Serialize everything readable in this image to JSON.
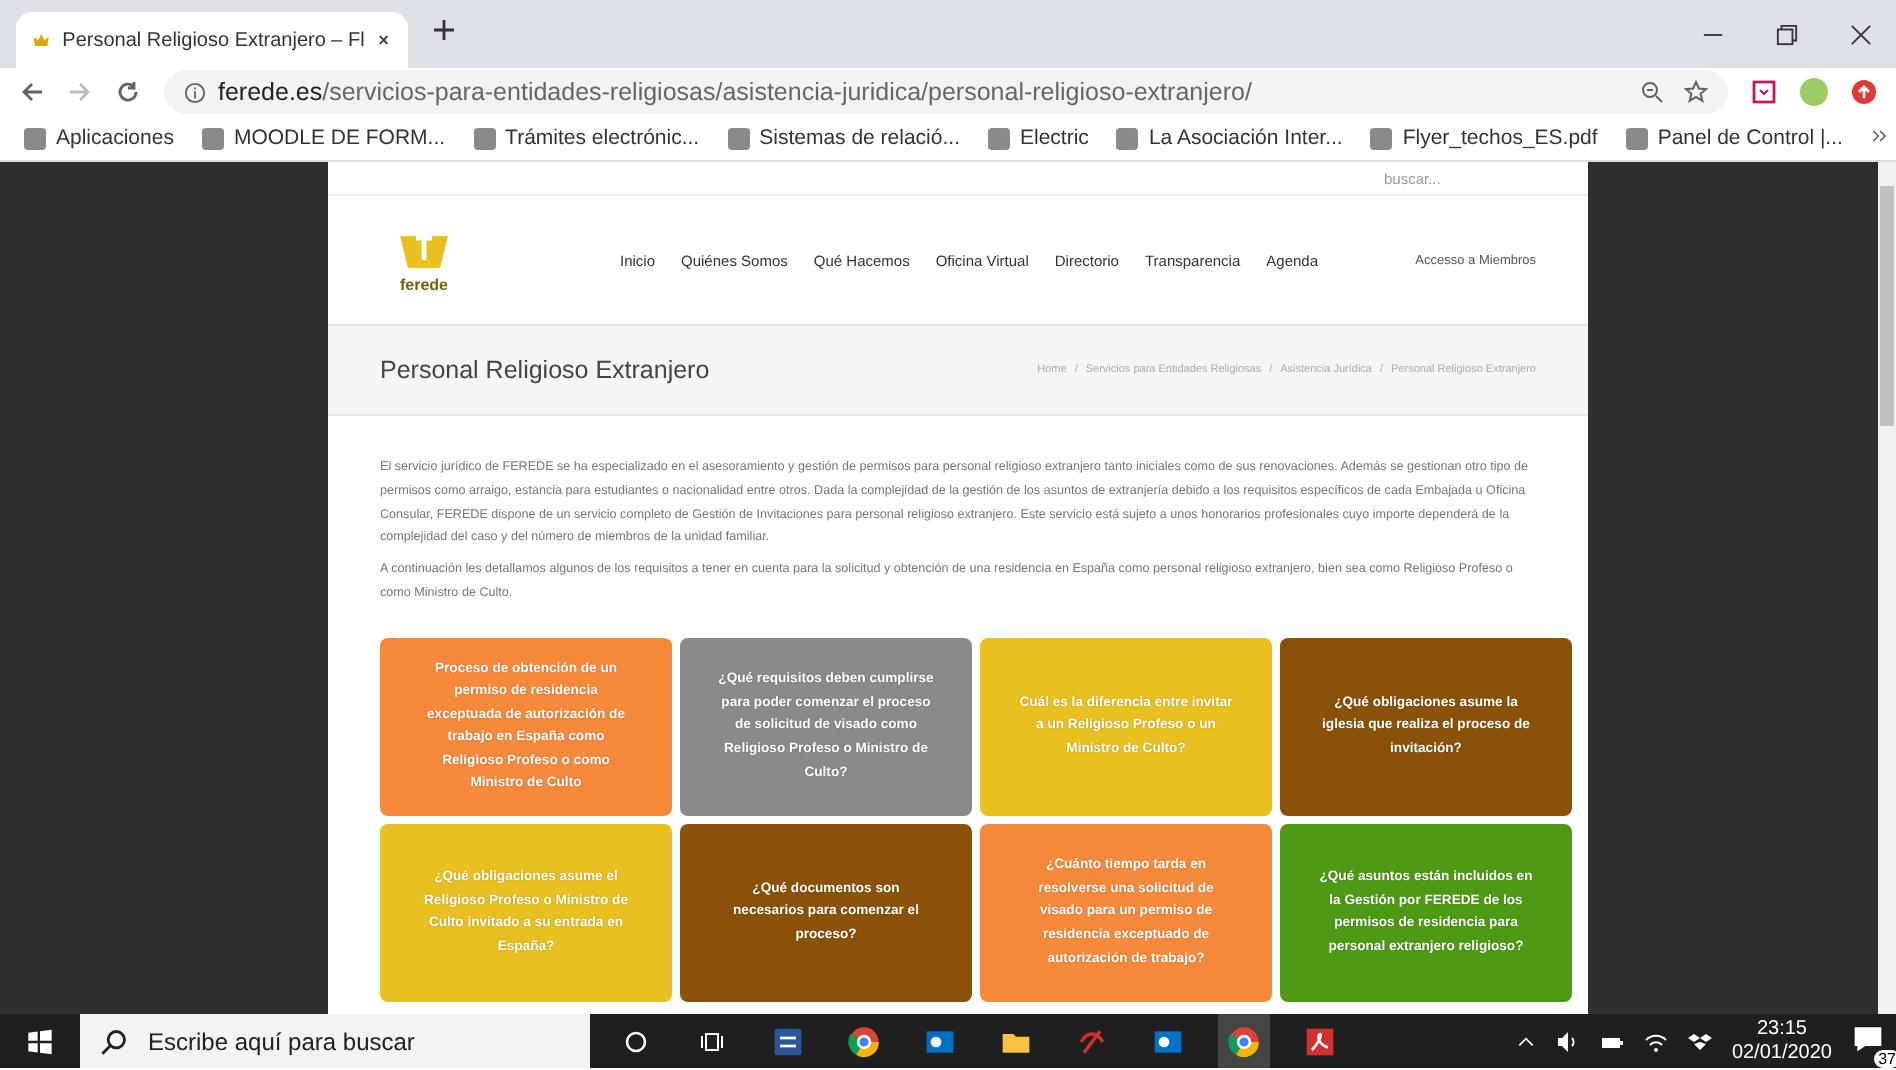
{
  "browser": {
    "tab_title": "Personal Religioso Extranjero – Fl",
    "address_host": "ferede.es",
    "address_path": "/servicios-para-entidades-religiosas/asistencia-juridica/personal-religioso-extranjero/",
    "bookmarks": [
      "Aplicaciones",
      "MOODLE DE FORM...",
      "Trámites electrónic...",
      "Sistemas de relació...",
      "Electric",
      "La Asociación Inter...",
      "Flyer_techos_ES.pdf",
      "Panel de Control |..."
    ]
  },
  "site": {
    "search": {
      "placeholder": "buscar..."
    },
    "logo_text": "ferede",
    "nav": [
      "Inicio",
      "Quiénes Somos",
      "Qué Hacemos",
      "Oficina Virtual",
      "Directorio",
      "Transparencia",
      "Agenda"
    ],
    "members_link": "Accesso a Miembros",
    "page_title": "Personal Religioso Extranjero",
    "breadcrumb_separator": "/",
    "breadcrumb": [
      "Home",
      "Servicios para Entidades Religiosas",
      "Asistencia Jurídica",
      "Personal Religioso Extranjero"
    ],
    "paragraphs": [
      "El servicio jurídico de FEREDE se ha especializado en el asesoramiento y gestión de permisos para personal religioso extranjero tanto iniciales como de sus renovaciones. Además se gestionan otro tipo de permisos como arraigo, estancia para estudiantes o nacionalidad entre otros. Dada la complejidad de la gestión de los asuntos de extranjería debido a los requisitos específicos de cada Embajada u Oficina Consular, FEREDE dispone de un servicio completo de Gestión de Invitaciones para personal religioso extranjero. Este servicio está sujeto a unos honorarios profesionales cuyo importe dependerá de la complejidad del caso y del número de miembros de la unidad familiar.",
      "A continuación les detallamos algunos de los requisitos a tener en cuenta para la solicitud y obtención de una residencia en España como personal religioso extranjero, bien sea como Religioso Profeso o como Ministro de Culto."
    ],
    "cards": [
      {
        "text": "Proceso de obtención de un permiso de residencia exceptuada de autorización de trabajo en España como Religioso Profeso o como Ministro de Culto",
        "color": "#f7893a"
      },
      {
        "text": "¿Qué requisitos deben cumplirse para poder comenzar el proceso de solicitud de visado como Religioso Profeso o Ministro de Culto?",
        "color": "#8a8a8a"
      },
      {
        "text": "Cuál es la diferencia entre invitar a un Religioso Profeso o un Ministro de Culto?",
        "color": "#e8c020"
      },
      {
        "text": "¿Qué obligaciones asume la iglesia que realiza el proceso de invitación?",
        "color": "#8a5208"
      },
      {
        "text": "¿Qué obligaciones asume el Religioso Profeso o Ministro de Culto invitado a su entrada en España?",
        "color": "#e8c020"
      },
      {
        "text": "¿Qué documentos son necesarios para comenzar el proceso?",
        "color": "#8a5208"
      },
      {
        "text": "¿Cuánto tiempo tarda en resolverse una solicitud de visado para un permiso de residencia exceptuado de autorización de trabajo?",
        "color": "#f7893a"
      },
      {
        "text": "¿Qué asuntos están incluidos en la Gestión por FEREDE de los permisos de residencia para personal extranjero religioso?",
        "color": "#4e9a14"
      }
    ]
  },
  "taskbar": {
    "search": {
      "placeholder": "Escribe aquí para buscar"
    },
    "time": "23:15",
    "date": "02/01/2020",
    "notifications": "37"
  }
}
